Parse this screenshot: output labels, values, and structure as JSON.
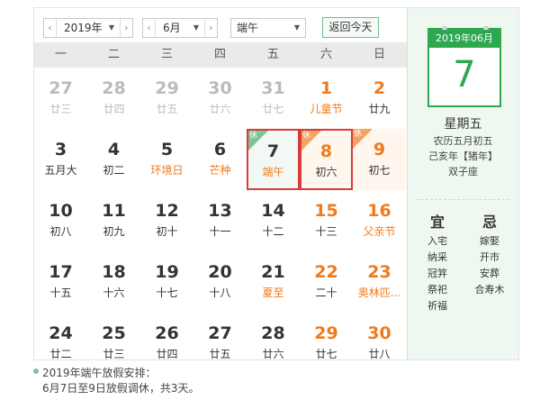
{
  "toolbar": {
    "year_value": "2019年",
    "month_value": "6月",
    "festival_value": "端午",
    "today_button": "返回今天"
  },
  "weekdays": [
    "一",
    "二",
    "三",
    "四",
    "五",
    "六",
    "日"
  ],
  "weeks": [
    [
      {
        "n": "27",
        "s": "廿三",
        "other": true
      },
      {
        "n": "28",
        "s": "廿四",
        "other": true
      },
      {
        "n": "29",
        "s": "廿五",
        "other": true
      },
      {
        "n": "30",
        "s": "廿六",
        "other": true
      },
      {
        "n": "31",
        "s": "廿七",
        "other": true
      },
      {
        "n": "1",
        "s": "儿童节",
        "weekend": true,
        "festival": true
      },
      {
        "n": "2",
        "s": "廿九",
        "weekend": true
      }
    ],
    [
      {
        "n": "3",
        "s": "五月大"
      },
      {
        "n": "4",
        "s": "初二"
      },
      {
        "n": "5",
        "s": "环境日",
        "festival": true
      },
      {
        "n": "6",
        "s": "芒种",
        "festival": true
      },
      {
        "n": "7",
        "s": "端午",
        "festival": true,
        "holiday": true,
        "selected": true,
        "today": true,
        "badge": "休"
      },
      {
        "n": "8",
        "s": "初六",
        "weekend": true,
        "holiday": true,
        "selected": true,
        "badge": "休"
      },
      {
        "n": "9",
        "s": "初七",
        "weekend": true,
        "holiday": true,
        "badge": "休"
      }
    ],
    [
      {
        "n": "10",
        "s": "初八"
      },
      {
        "n": "11",
        "s": "初九"
      },
      {
        "n": "12",
        "s": "初十"
      },
      {
        "n": "13",
        "s": "十一"
      },
      {
        "n": "14",
        "s": "十二"
      },
      {
        "n": "15",
        "s": "十三",
        "weekend": true
      },
      {
        "n": "16",
        "s": "父亲节",
        "weekend": true,
        "festival": true
      }
    ],
    [
      {
        "n": "17",
        "s": "十五"
      },
      {
        "n": "18",
        "s": "十六"
      },
      {
        "n": "19",
        "s": "十七"
      },
      {
        "n": "20",
        "s": "十八"
      },
      {
        "n": "21",
        "s": "夏至",
        "festival": true
      },
      {
        "n": "22",
        "s": "二十",
        "weekend": true
      },
      {
        "n": "23",
        "s": "奥林匹...",
        "weekend": true,
        "festival": true
      }
    ],
    [
      {
        "n": "24",
        "s": "廿二"
      },
      {
        "n": "25",
        "s": "廿三"
      },
      {
        "n": "26",
        "s": "廿四"
      },
      {
        "n": "27",
        "s": "廿五"
      },
      {
        "n": "28",
        "s": "廿六"
      },
      {
        "n": "29",
        "s": "廿七",
        "weekend": true
      },
      {
        "n": "30",
        "s": "廿八",
        "weekend": true
      }
    ]
  ],
  "side": {
    "header": "2019年06月",
    "day": "7",
    "weekday": "星期五",
    "lunar": "农历五月初五",
    "ganzhi": "己亥年【猪年】",
    "zodiac": "双子座",
    "yi_title": "宜",
    "ji_title": "忌",
    "yi_items": [
      "入宅",
      "纳采",
      "冠笄",
      "祭祀",
      "祈福"
    ],
    "ji_items": [
      "嫁娶",
      "开市",
      "安葬",
      "合寿木"
    ]
  },
  "note": {
    "line1": "2019年端午放假安排：",
    "line2": "6月7日至9日放假调休，共3天。"
  },
  "colors": {
    "accent_green": "#2ea84f",
    "weekend_orange": "#f07b1c",
    "selected_red": "#d93a3a"
  }
}
